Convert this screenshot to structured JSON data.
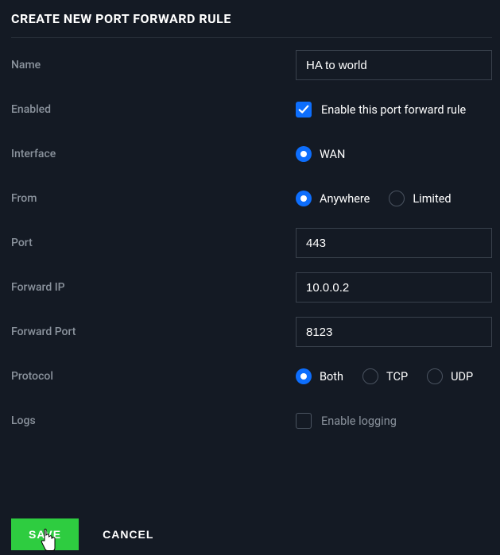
{
  "title": "CREATE NEW PORT FORWARD RULE",
  "labels": {
    "name": "Name",
    "enabled": "Enabled",
    "interface": "Interface",
    "from": "From",
    "port": "Port",
    "forward_ip": "Forward IP",
    "forward_port": "Forward Port",
    "protocol": "Protocol",
    "logs": "Logs"
  },
  "values": {
    "name": "HA to world",
    "port": "443",
    "forward_ip": "10.0.0.2",
    "forward_port": "8123"
  },
  "enabled": {
    "checked": true,
    "label": "Enable this port forward rule"
  },
  "interface": {
    "options": [
      {
        "label": "WAN",
        "selected": true
      }
    ]
  },
  "from": {
    "options": [
      {
        "label": "Anywhere",
        "selected": true
      },
      {
        "label": "Limited",
        "selected": false
      }
    ]
  },
  "protocol": {
    "options": [
      {
        "label": "Both",
        "selected": true
      },
      {
        "label": "TCP",
        "selected": false
      },
      {
        "label": "UDP",
        "selected": false
      }
    ]
  },
  "logs": {
    "checked": false,
    "label": "Enable logging"
  },
  "buttons": {
    "save": "SAVE",
    "cancel": "CANCEL"
  }
}
